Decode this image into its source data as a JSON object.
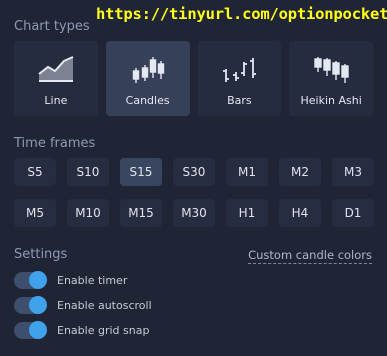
{
  "watermark": "https://tinyurl.com/optionpocket",
  "chart_types": {
    "title": "Chart types",
    "items": [
      {
        "label": "Line",
        "icon": "line-chart-icon",
        "selected": false
      },
      {
        "label": "Candles",
        "icon": "candles-chart-icon",
        "selected": true
      },
      {
        "label": "Bars",
        "icon": "bars-chart-icon",
        "selected": false
      },
      {
        "label": "Heikin Ashi",
        "icon": "heikin-ashi-chart-icon",
        "selected": false
      }
    ]
  },
  "time_frames": {
    "title": "Time frames",
    "items": [
      "S5",
      "S10",
      "S15",
      "S30",
      "M1",
      "M2",
      "M3",
      "M5",
      "M10",
      "M15",
      "M30",
      "H1",
      "H4",
      "D1"
    ],
    "selected": "S15"
  },
  "settings": {
    "title": "Settings",
    "custom_link": "Custom candle colors",
    "toggles": [
      {
        "label": "Enable timer",
        "on": true
      },
      {
        "label": "Enable autoscroll",
        "on": true
      },
      {
        "label": "Enable grid snap",
        "on": true
      }
    ]
  },
  "colors": {
    "background": "#1f2535",
    "accent": "#3fa2ea",
    "watermark": "#ffff1a"
  }
}
